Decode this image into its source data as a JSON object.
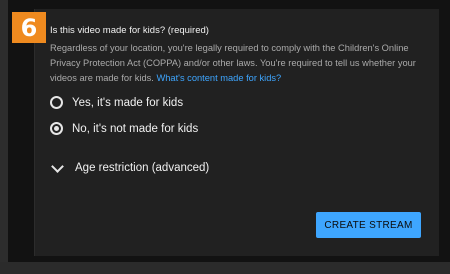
{
  "step_badge": "6",
  "kids_section": {
    "title": "Is this video made for kids? (required)",
    "description": "Regardless of your location, you're legally required to comply with the Children's Online Privacy Protection Act (COPPA) and/or other laws. You're required to tell us whether your videos are made for kids.",
    "link_text": "What's content made for kids?",
    "options": [
      {
        "label": "Yes, it's made for kids",
        "selected": false
      },
      {
        "label": "No, it's not made for kids",
        "selected": true
      }
    ]
  },
  "age_restriction": {
    "label": "Age restriction (advanced)",
    "icon": "chevron-down-icon"
  },
  "actions": {
    "create_stream_label": "CREATE STREAM"
  },
  "colors": {
    "badge": "#ef8a1f",
    "accent": "#3ea6ff",
    "panel": "#212121"
  }
}
